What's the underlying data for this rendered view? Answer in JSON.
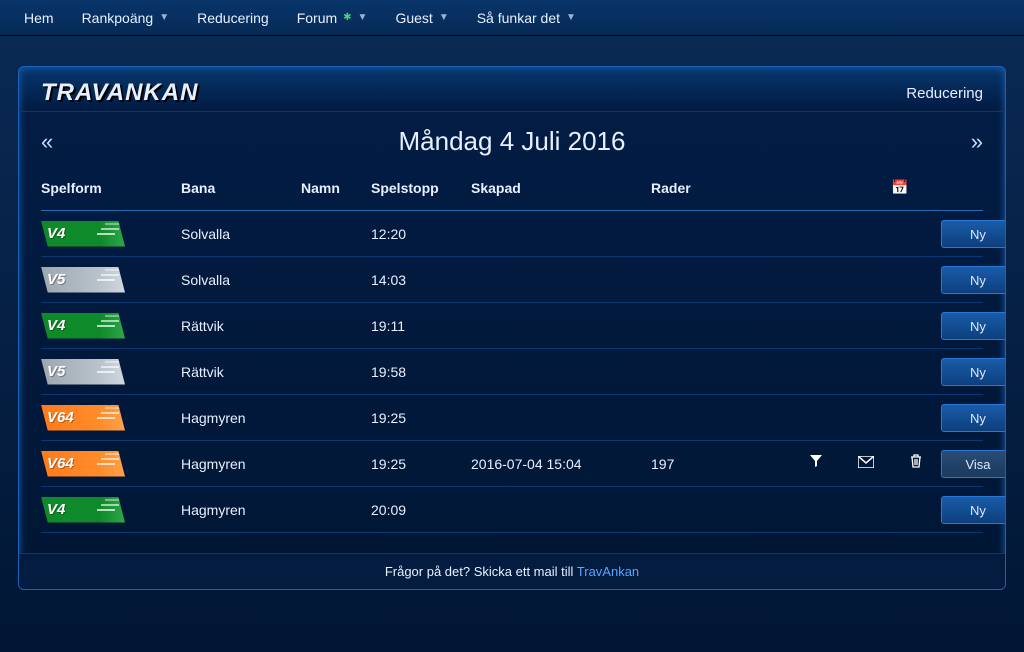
{
  "nav": {
    "hem": "Hem",
    "rankpoang": "Rankpoäng",
    "reducering": "Reducering",
    "forum": "Forum",
    "guest": "Guest",
    "safunkar": "Så funkar det"
  },
  "panel": {
    "logo": "TRAVANKAN",
    "action": "Reducering",
    "date_title": "Måndag 4 Juli 2016"
  },
  "columns": {
    "spelform": "Spelform",
    "bana": "Bana",
    "namn": "Namn",
    "spelstopp": "Spelstopp",
    "skapad": "Skapad",
    "rader": "Rader"
  },
  "buttons": {
    "ny": "Ny",
    "visa": "Visa"
  },
  "rows": [
    {
      "type": "v4",
      "type_label": "V4",
      "bana": "Solvalla",
      "namn": "",
      "spelstopp": "12:20",
      "skapad": "",
      "rader": "",
      "funnel": false,
      "mail": false,
      "trash": false,
      "btn": "ny"
    },
    {
      "type": "v5",
      "type_label": "V5",
      "bana": "Solvalla",
      "namn": "",
      "spelstopp": "14:03",
      "skapad": "",
      "rader": "",
      "funnel": false,
      "mail": false,
      "trash": false,
      "btn": "ny"
    },
    {
      "type": "v4",
      "type_label": "V4",
      "bana": "Rättvik",
      "namn": "",
      "spelstopp": "19:11",
      "skapad": "",
      "rader": "",
      "funnel": false,
      "mail": false,
      "trash": false,
      "btn": "ny"
    },
    {
      "type": "v5",
      "type_label": "V5",
      "bana": "Rättvik",
      "namn": "",
      "spelstopp": "19:58",
      "skapad": "",
      "rader": "",
      "funnel": false,
      "mail": false,
      "trash": false,
      "btn": "ny"
    },
    {
      "type": "v64",
      "type_label": "V64",
      "bana": "Hagmyren",
      "namn": "",
      "spelstopp": "19:25",
      "skapad": "",
      "rader": "",
      "funnel": false,
      "mail": false,
      "trash": false,
      "btn": "ny"
    },
    {
      "type": "v64",
      "type_label": "V64",
      "bana": "Hagmyren",
      "namn": "",
      "spelstopp": "19:25",
      "skapad": "2016-07-04 15:04",
      "rader": "197",
      "funnel": true,
      "mail": true,
      "trash": true,
      "btn": "visa"
    },
    {
      "type": "v4",
      "type_label": "V4",
      "bana": "Hagmyren",
      "namn": "",
      "spelstopp": "20:09",
      "skapad": "",
      "rader": "",
      "funnel": false,
      "mail": false,
      "trash": false,
      "btn": "ny"
    }
  ],
  "footer": {
    "text": "Frågor på det? Skicka ett mail till ",
    "link": "TravAnkan"
  }
}
